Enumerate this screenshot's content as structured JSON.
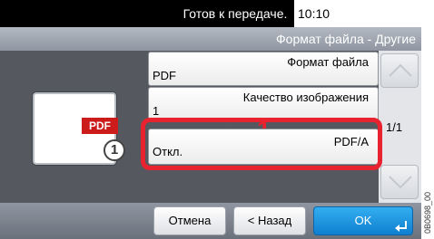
{
  "status": {
    "message": "Готов к передаче.",
    "time": "10:10"
  },
  "title": "Формат файла - Другие",
  "preview": {
    "tag": "PDF",
    "marker": "1"
  },
  "list": [
    {
      "title": "Формат файла",
      "value": "PDF"
    },
    {
      "title": "Качество изображения",
      "value": "1"
    },
    {
      "title": "PDF/A",
      "value": "Откл."
    }
  ],
  "annotation": {
    "step": "1"
  },
  "pager": {
    "label": "1/1"
  },
  "buttons": {
    "cancel": "Отмена",
    "back": "< Назад",
    "ok": "OK"
  },
  "side_code": "0B0698_00",
  "colors": {
    "highlight": "#e8222f",
    "ok_button": "#1a94e0",
    "panel": "#55585e"
  },
  "icons": [
    "chevron-up-icon",
    "chevron-down-icon",
    "enter-icon"
  ]
}
